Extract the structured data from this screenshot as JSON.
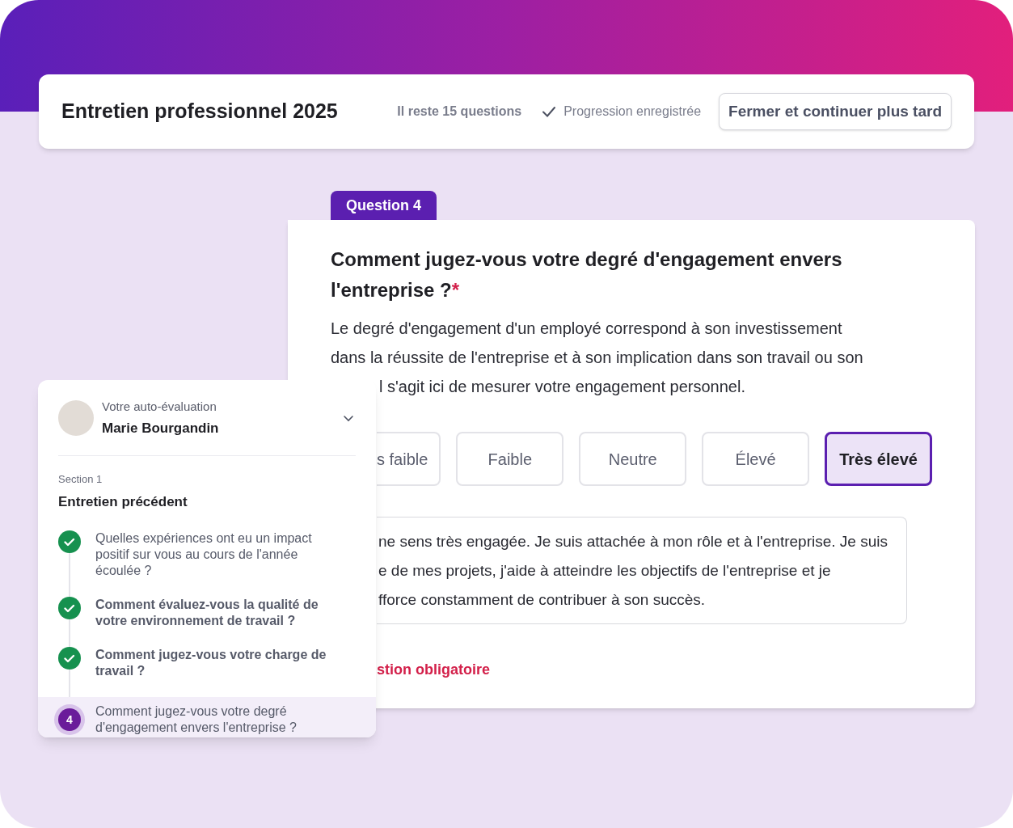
{
  "header": {
    "title": "Entretien professionnel 2025",
    "remaining": "Il reste 15 questions",
    "saved": "Progression enregistrée",
    "close_button": "Fermer et continuer plus tard"
  },
  "question": {
    "tab": "Question 4",
    "title": "Comment jugez-vous votre degré d'engagement envers l'entreprise ?",
    "required_mark": "*",
    "description_lines": [
      "Le degré d'engagement d'un employé correspond à son investissement",
      "dans la réussite de l'entreprise et à son implication dans son travail ou son"
    ],
    "description_fragment": "l s'agit ici de mesurer votre engagement personnel.",
    "options": [
      {
        "label": "s faible",
        "selected": false,
        "clipped": true
      },
      {
        "label": "Faible",
        "selected": false,
        "clipped": false
      },
      {
        "label": "Neutre",
        "selected": false,
        "clipped": false
      },
      {
        "label": "Élevé",
        "selected": false,
        "clipped": false
      },
      {
        "label": "Très élevé",
        "selected": true,
        "clipped": false
      }
    ],
    "answer_lines": [
      "ne sens très engagée. Je suis attachée à mon rôle et à l'entreprise. Je suis",
      "e de mes projets, j'aide à atteindre les objectifs de l'entreprise et je",
      "fforce constamment de contribuer à son succès."
    ],
    "required_note": "stion obligatoire"
  },
  "sidebar": {
    "subtitle": "Votre auto-évaluation",
    "name": "Marie Bourgandin",
    "expanded": false,
    "section_label": "Section 1",
    "section_title": "Entretien précédent",
    "steps": [
      {
        "kind": "done",
        "text": "Quelles expériences ont eu un impact positif sur vous au cours de l'année écoulée ?",
        "bold": false,
        "selected": false
      },
      {
        "kind": "done",
        "text": "Comment évaluez-vous la qualité de votre environnement de travail ?",
        "bold": true,
        "selected": false
      },
      {
        "kind": "done",
        "text": "Comment jugez-vous votre charge de travail ?",
        "bold": true,
        "selected": false
      },
      {
        "kind": "current",
        "number": "4",
        "text": "Comment jugez-vous votre degré d'engagement envers l'entreprise ?",
        "bold": false,
        "selected": true
      }
    ]
  }
}
